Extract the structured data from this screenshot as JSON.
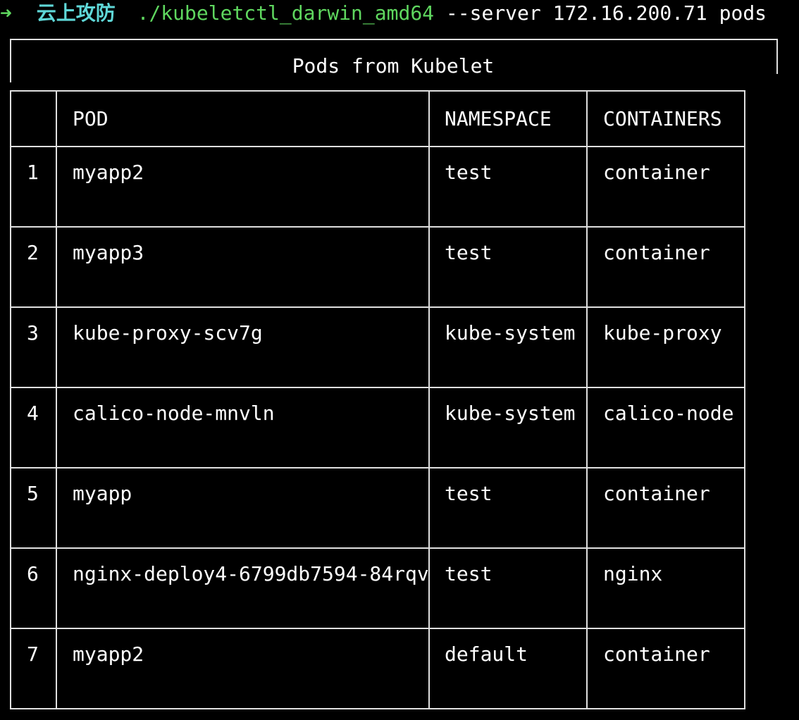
{
  "prompt": {
    "arrow": "➜",
    "host": "云上攻防",
    "command": "./kubeletctl_darwin_amd64",
    "args": "--server 172.16.200.71 pods"
  },
  "table": {
    "title": "Pods from Kubelet",
    "headers": [
      "",
      "POD",
      "NAMESPACE",
      "CONTAINERS"
    ],
    "rows": [
      {
        "index": "1",
        "pod": "myapp2",
        "namespace": "test",
        "containers": "container"
      },
      {
        "index": "2",
        "pod": "myapp3",
        "namespace": "test",
        "containers": "container"
      },
      {
        "index": "3",
        "pod": "kube-proxy-scv7g",
        "namespace": "kube-system",
        "containers": "kube-proxy"
      },
      {
        "index": "4",
        "pod": "calico-node-mnvln",
        "namespace": "kube-system",
        "containers": "calico-node"
      },
      {
        "index": "5",
        "pod": "myapp",
        "namespace": "test",
        "containers": "container"
      },
      {
        "index": "6",
        "pod": "nginx-deploy4-6799db7594-84rqv",
        "namespace": "test",
        "containers": "nginx"
      },
      {
        "index": "7",
        "pod": "myapp2",
        "namespace": "default",
        "containers": "container"
      }
    ]
  },
  "colors": {
    "background": "#000000",
    "prompt_arrow": "#5fd75f",
    "prompt_host": "#5fd7d7",
    "command": "#5fd75f",
    "text": "#ffffff"
  }
}
